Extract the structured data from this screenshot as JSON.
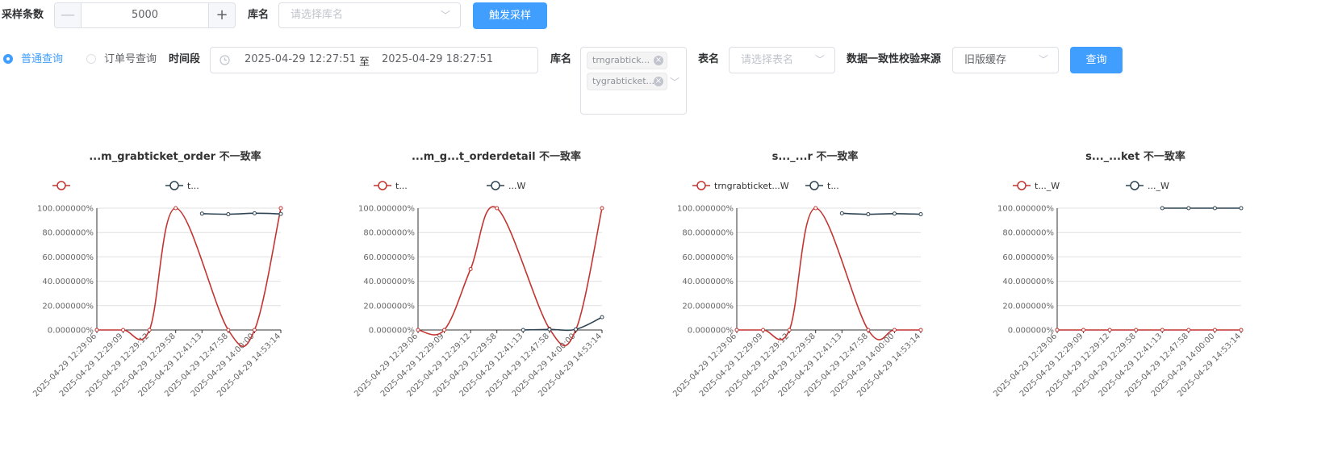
{
  "toolbar": {
    "sample_count_label": "采样条数",
    "sample_count_value": "5000",
    "minus": "—",
    "plus": "+",
    "db_label": "库名",
    "db_placeholder": "请选择库名",
    "trigger_button": "触发采样"
  },
  "filters": {
    "radio_normal": "普通查询",
    "radio_order": "订单号查询",
    "time_label": "时间段",
    "time_start": "2025-04-29 12:27:51",
    "time_sep": "至",
    "time_end": "2025-04-29 18:27:51",
    "db_label": "库名",
    "db_tags": [
      "trngrabtick...",
      "tygrabticket..."
    ],
    "table_label": "表名",
    "table_placeholder": "请选择表名",
    "source_label": "数据一致性校验来源",
    "source_value": "旧版缓存",
    "query_button": "查询"
  },
  "colors": {
    "red": "#c23531",
    "navy": "#2f4554",
    "primary": "#409eff"
  },
  "icons": {
    "clock": "clock-icon",
    "chevron": "chevron-down-icon",
    "close": "close-icon"
  },
  "chart_data": [
    {
      "type": "line",
      "title": "...m_grabticket_order 不一致率",
      "x": [
        "2025-04-29 12:29:06",
        "2025-04-29 12:29:09",
        "2025-04-29 12:29:12",
        "2025-04-29 12:29:58",
        "2025-04-29 12:41:13",
        "2025-04-29 12:47:58",
        "2025-04-29 14:00:00",
        "2025-04-29 14:53:14"
      ],
      "ylim": [
        0,
        100
      ],
      "yticks": [
        "0.000000%",
        "20.000000%",
        "40.000000%",
        "60.000000%",
        "80.000000%",
        "100.000000%"
      ],
      "series": [
        {
          "name": "",
          "color": "#c23531",
          "values": [
            0,
            0,
            0,
            100,
            null,
            0,
            0,
            100
          ]
        },
        {
          "name": "t...",
          "color": "#2f4554",
          "values": [
            null,
            null,
            null,
            null,
            95.5,
            95,
            95.8,
            95.3
          ]
        }
      ]
    },
    {
      "type": "line",
      "title": "...m_g...t_orderdetail 不一致率",
      "x": [
        "2025-04-29 12:29:06",
        "2025-04-29 12:29:09",
        "2025-04-29 12:29:12",
        "2025-04-29 12:29:58",
        "2025-04-29 12:41:13",
        "2025-04-29 12:47:58",
        "2025-04-29 14:00:00",
        "2025-04-29 14:53:14"
      ],
      "ylim": [
        0,
        100
      ],
      "yticks": [
        "0.000000%",
        "20.000000%",
        "40.000000%",
        "60.000000%",
        "80.000000%",
        "100.000000%"
      ],
      "series": [
        {
          "name": "t...",
          "color": "#c23531",
          "values": [
            0,
            0,
            50,
            100,
            null,
            1,
            0,
            100
          ]
        },
        {
          "name": "...W",
          "color": "#2f4554",
          "values": [
            null,
            null,
            null,
            null,
            0,
            0.5,
            0.5,
            10.5
          ]
        }
      ]
    },
    {
      "type": "line",
      "title": "s..._...r 不一致率",
      "x": [
        "2025-04-29 12:29:06",
        "2025-04-29 12:29:09",
        "2025-04-29 12:29:12",
        "2025-04-29 12:29:58",
        "2025-04-29 12:41:13",
        "2025-04-29 12:47:58",
        "2025-04-29 14:00:00",
        "2025-04-29 14:53:14"
      ],
      "ylim": [
        0,
        100
      ],
      "yticks": [
        "0.000000%",
        "20.000000%",
        "40.000000%",
        "60.000000%",
        "80.000000%",
        "100.000000%"
      ],
      "series": [
        {
          "name": "trngrabticket...W",
          "color": "#c23531",
          "values": [
            0,
            0,
            0,
            100,
            null,
            0,
            0,
            0
          ]
        },
        {
          "name": "t...",
          "color": "#2f4554",
          "values": [
            null,
            null,
            null,
            null,
            95.8,
            95,
            95.5,
            95
          ]
        }
      ]
    },
    {
      "type": "line",
      "title": "s..._...ket 不一致率",
      "x": [
        "2025-04-29 12:29:06",
        "2025-04-29 12:29:09",
        "2025-04-29 12:29:12",
        "2025-04-29 12:29:58",
        "2025-04-29 12:41:13",
        "2025-04-29 12:47:58",
        "2025-04-29 14:00:00",
        "2025-04-29 14:53:14"
      ],
      "ylim": [
        0,
        100
      ],
      "yticks": [
        "0.000000%",
        "20.000000%",
        "40.000000%",
        "60.000000%",
        "80.000000%",
        "100.000000%"
      ],
      "series": [
        {
          "name": "t..._W",
          "color": "#c23531",
          "values": [
            0,
            0,
            0,
            0,
            0,
            0,
            0,
            0
          ]
        },
        {
          "name": "..._W",
          "color": "#2f4554",
          "values": [
            null,
            null,
            null,
            null,
            100,
            100,
            100,
            100
          ]
        }
      ]
    }
  ]
}
